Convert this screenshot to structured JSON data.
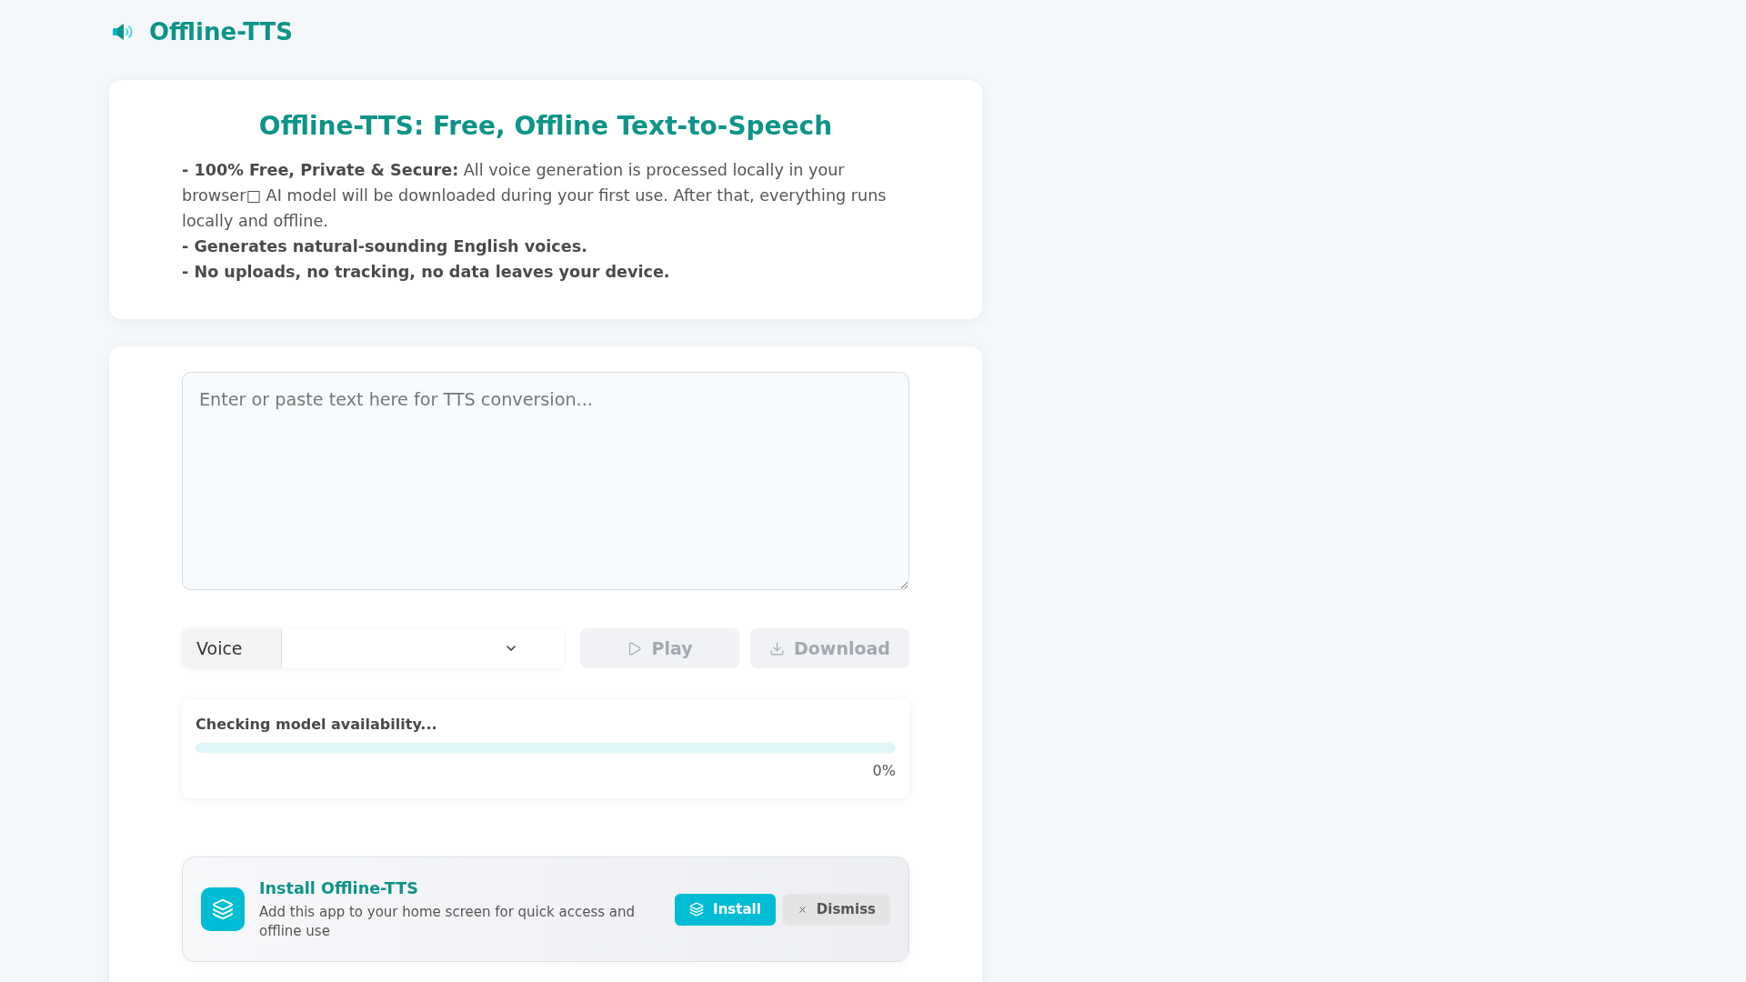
{
  "header": {
    "title": "Offline-TTS"
  },
  "intro": {
    "heading": "Offline-TTS: Free, Offline Text-to-Speech",
    "points": [
      {
        "text": "**- 100% Free, Private & Secure:** All voice generation is processed locally in your browser□ AI model will be downloaded during your first use. After that, everything runs locally and offline.",
        "bold": false
      },
      {
        "text": "- Generates natural-sounding English voices.",
        "bold": true
      },
      {
        "text": "- No uploads, no tracking, no data leaves your device.",
        "bold": true
      }
    ]
  },
  "editor": {
    "placeholder": "Enter or paste text here for TTS conversion..."
  },
  "controls": {
    "voice": {
      "label": "Voice"
    },
    "buttons": [
      {
        "kind": "play",
        "label": "Play",
        "disabled": true
      },
      {
        "kind": "download",
        "label": "Download",
        "disabled": true
      }
    ]
  },
  "progress": {
    "status": "Checking model availability...",
    "level": 0,
    "reading": "0%"
  },
  "install_banner": {
    "title": "Install Offline-TTS",
    "description": "Add this app to your home screen for quick access and offline use",
    "buttons": [
      {
        "kind": "install",
        "label": "Install"
      },
      {
        "kind": "dismiss",
        "label": "Dismiss"
      }
    ]
  }
}
